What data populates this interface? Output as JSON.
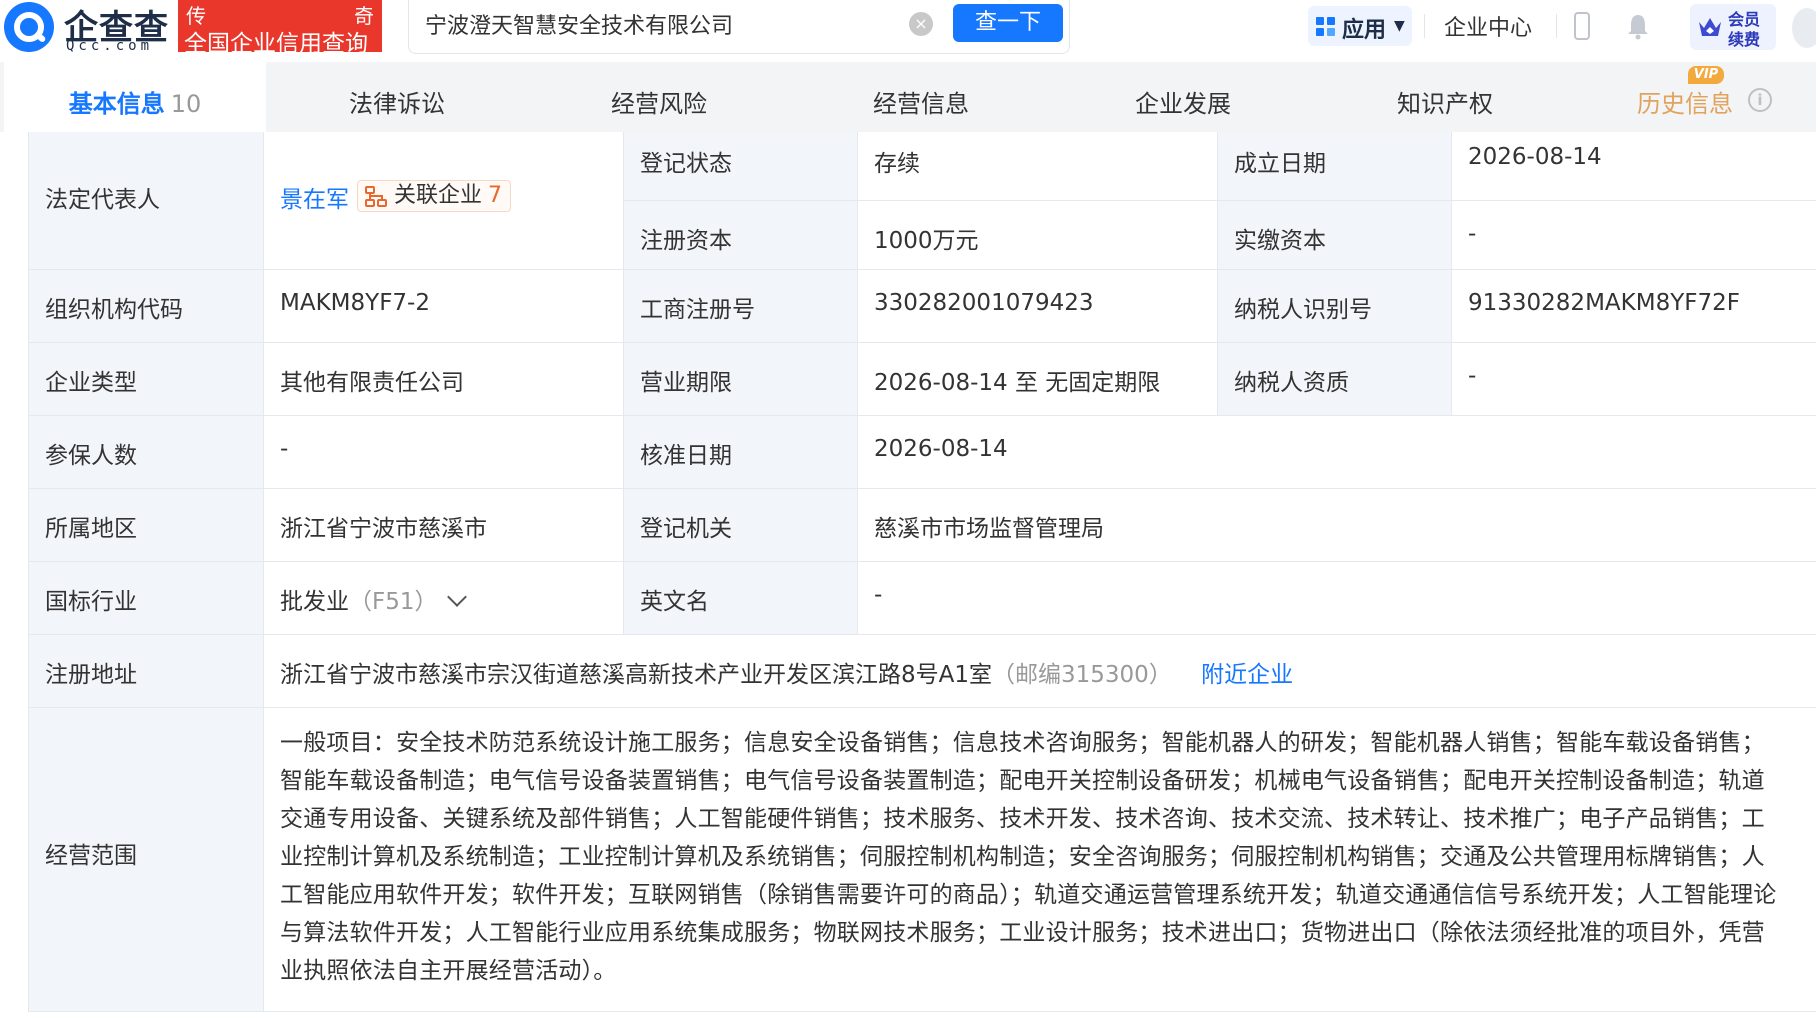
{
  "header": {
    "logo_name": "企查查",
    "logo_sub": "Qcc.com",
    "slogan_top_left": "传",
    "slogan_top_right": "奇",
    "slogan_main": "全国企业信用查询",
    "search_value": "宁波澄天智慧安全技术有限公司",
    "search_button": "查一下",
    "apps_label": "应用",
    "enterprise_center": "企业中心",
    "vip_line1": "会员",
    "vip_line2": "续费",
    "accent_color": "#1677ff",
    "slogan_color": "#e9372c"
  },
  "tabs": [
    {
      "label": "基本信息",
      "count": "10"
    },
    {
      "label": "法律诉讼"
    },
    {
      "label": "经营风险"
    },
    {
      "label": "经营信息"
    },
    {
      "label": "企业发展"
    },
    {
      "label": "知识产权"
    },
    {
      "label": "历史信息",
      "tag": "VIP"
    }
  ],
  "info": {
    "legal_rep_label": "法定代表人",
    "legal_rep_name": "景在军",
    "related_label": "关联企业",
    "related_count": "7",
    "reg_status_label": "登记状态",
    "reg_status": "存续",
    "est_date_label": "成立日期",
    "est_date": "2026-08-14",
    "reg_capital_label": "注册资本",
    "reg_capital": "1000万元",
    "paid_capital_label": "实缴资本",
    "paid_capital": "-",
    "org_code_label": "组织机构代码",
    "org_code": "MAKM8YF7-2",
    "biz_reg_no_label": "工商注册号",
    "biz_reg_no": "330282001079423",
    "taxpayer_id_label": "纳税人识别号",
    "taxpayer_id": "91330282MAKM8YF72F",
    "company_type_label": "企业类型",
    "company_type": "其他有限责任公司",
    "biz_term_label": "营业期限",
    "biz_term": "2026-08-14 至 无固定期限",
    "taxpayer_qual_label": "纳税人资质",
    "taxpayer_qual": "-",
    "insured_label": "参保人数",
    "insured": "-",
    "approval_date_label": "核准日期",
    "approval_date": "2026-08-14",
    "region_label": "所属地区",
    "region": "浙江省宁波市慈溪市",
    "reg_authority_label": "登记机关",
    "reg_authority": "慈溪市市场监督管理局",
    "industry_label": "国标行业",
    "industry": "批发业",
    "industry_code": "（F51）",
    "english_name_label": "英文名",
    "english_name": "-",
    "address_label": "注册地址",
    "address": "浙江省宁波市慈溪市宗汉街道慈溪高新技术产业开发区滨江路8号A1室",
    "postcode": "（邮编315300）",
    "nearby_link": "附近企业",
    "scope_label": "经营范围",
    "scope": "一般项目：安全技术防范系统设计施工服务；信息安全设备销售；信息技术咨询服务；智能机器人的研发；智能机器人销售；智能车载设备销售；智能车载设备制造；电气信号设备装置销售；电气信号设备装置制造；配电开关控制设备研发；机械电气设备销售；配电开关控制设备制造；轨道交通专用设备、关键系统及部件销售；人工智能硬件销售；技术服务、技术开发、技术咨询、技术交流、技术转让、技术推广；电子产品销售；工业控制计算机及系统制造；工业控制计算机及系统销售；伺服控制机构制造；安全咨询服务；伺服控制机构销售；交通及公共管理用标牌销售；人工智能应用软件开发；软件开发；互联网销售（除销售需要许可的商品）；轨道交通运营管理系统开发；轨道交通通信信号系统开发；人工智能理论与算法软件开发；人工智能行业应用系统集成服务；物联网技术服务；工业设计服务；技术进出口；货物进出口（除依法须经批准的项目外，凭营业执照依法自主开展经营活动）。"
  }
}
